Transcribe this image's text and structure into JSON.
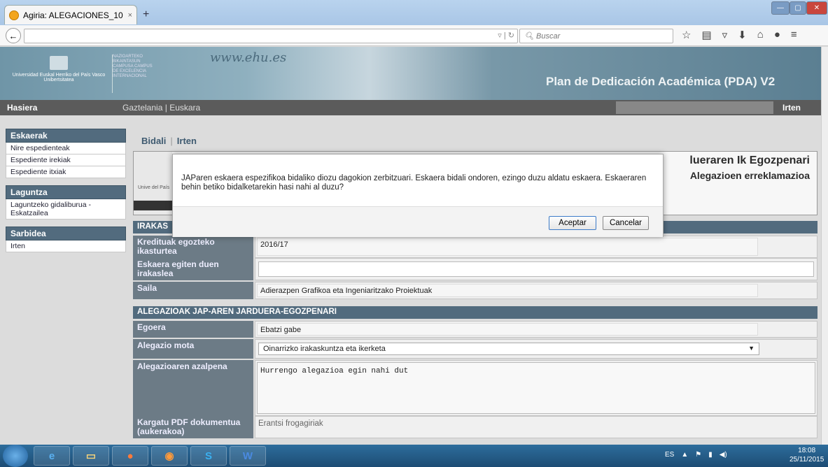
{
  "browser": {
    "tab_title": "Agiria: ALEGACIONES_10 - ...",
    "tab_close": "×",
    "new_tab": "+",
    "search_placeholder": "Buscar",
    "url_text": ""
  },
  "header": {
    "www_text": "www.ehu.es",
    "app_title": "Plan de Dedicación Académica (PDA) V2",
    "logo_text": "Universidad Euskal Herriko del País Vasco Unibertsitatea",
    "campus_text": "NAZIOARTEKO BIKAINTASUN CAMPUSA CAMPUS DE EXCELENCIA INTERNACIONAL"
  },
  "menu": {
    "home": "Hasiera",
    "lang_es": "Gaztelania",
    "lang_sep": "|",
    "lang_eu": "Euskara",
    "logout": "Irten"
  },
  "sidebar": {
    "sections": [
      {
        "title": "Eskaerak",
        "items": [
          "Nire espedienteak",
          "Espediente irekiak",
          "Espediente itxiak"
        ]
      },
      {
        "title": "Laguntza",
        "items": [
          "Laguntzeko gidaliburua - Eskatzailea"
        ]
      },
      {
        "title": "Sarbidea",
        "items": [
          "Irten"
        ]
      }
    ]
  },
  "actions": {
    "send": "Bidali",
    "sep": "|",
    "exit": "Irten"
  },
  "title_panel": {
    "line1": "lueraren Ik Egozpenari",
    "line2": "Alegazioen erreklamazioa",
    "logo_text": "Unive del País"
  },
  "section1": {
    "title": "IRAKAS"
  },
  "fields1": [
    {
      "label": "Kredituak egozteko ikasturtea",
      "value": "2016/17"
    },
    {
      "label": "Eskaera egiten duen irakaslea",
      "value": ""
    },
    {
      "label": "Saila",
      "value": "Adierazpen Grafikoa eta Ingeniaritzako Proiektuak"
    }
  ],
  "section2": {
    "title": "ALEGAZIOAK JAP-AREN JARDUERA-EGOZPENARI"
  },
  "fields2": {
    "egoera_label": "Egoera",
    "egoera_value": "Ebatzi gabe",
    "mota_label": "Alegazio mota",
    "mota_value": "Oinarrizko irakaskuntza eta ikerketa",
    "azalpena_label": "Alegazioaren azalpena",
    "azalpena_value": "Hurrengo alegazioa egin nahi dut",
    "pdf_label": "Kargatu PDF dokumentua (aukerakoa)",
    "pdf_link": "Erantsi frogagiriak"
  },
  "dialog": {
    "message": "JAParen eskaera espezifikoa bidaliko diozu dagokion zerbitzuari. Eskaera bidali ondoren, ezingo duzu aldatu eskaera. Eskaeraren behin betiko bidalketarekin hasi nahi al duzu?",
    "ok": "Aceptar",
    "cancel": "Cancelar"
  },
  "taskbar": {
    "lang": "ES",
    "time": "18:08",
    "date": "25/11/2015"
  }
}
